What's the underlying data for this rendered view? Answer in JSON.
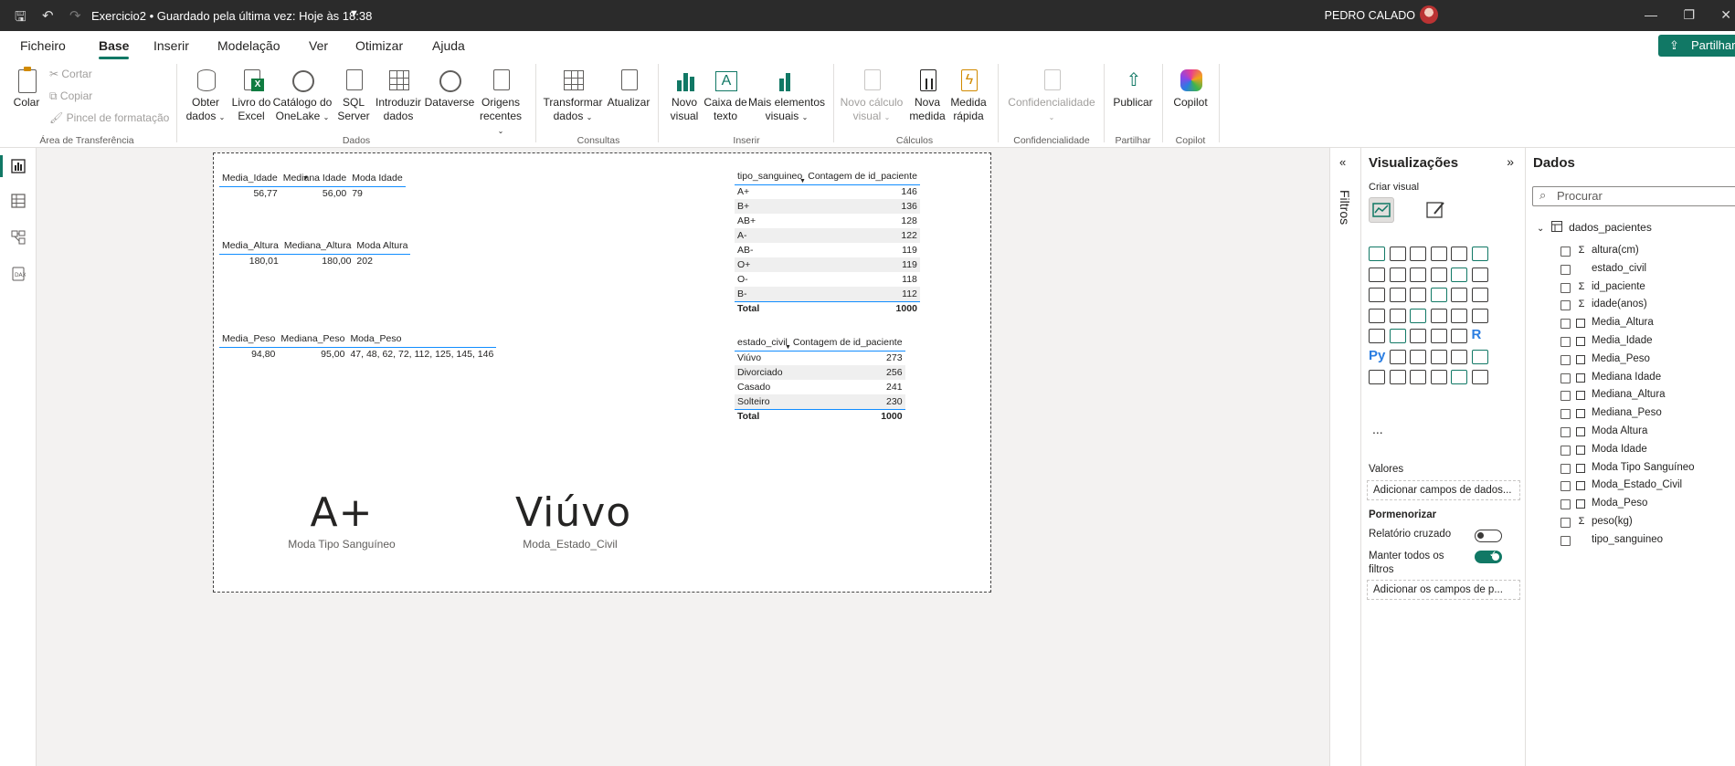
{
  "titlebar": {
    "title": "Exercicio2 • Guardado pela última vez: Hoje às 18:38",
    "user": "PEDRO CALADO"
  },
  "menu": {
    "tabs": [
      "Ficheiro",
      "Base",
      "Inserir",
      "Modelação",
      "Ver",
      "Otimizar",
      "Ajuda"
    ],
    "share": "Partilhar"
  },
  "ribbon": {
    "paste": "Colar",
    "cut": "Cortar",
    "copy": "Copiar",
    "format_painter": "Pincel de formatação",
    "get_data": [
      "Obter",
      "dados"
    ],
    "excel": [
      "Livro do",
      "Excel"
    ],
    "onelake": [
      "Catálogo do",
      "OneLake"
    ],
    "sql": [
      "SQL",
      "Server"
    ],
    "enter_data": [
      "Introduzir",
      "dados"
    ],
    "dataverse": "Dataverse",
    "recent": [
      "Origens",
      "recentes"
    ],
    "transform": [
      "Transformar",
      "dados"
    ],
    "refresh": "Atualizar",
    "new_visual": [
      "Novo",
      "visual"
    ],
    "text_box": [
      "Caixa de",
      "texto"
    ],
    "more_visuals": [
      "Mais elementos",
      "visuais"
    ],
    "new_calc": [
      "Novo cálculo",
      "visual"
    ],
    "new_measure": [
      "Nova",
      "medida"
    ],
    "quick_measure": [
      "Medida",
      "rápida"
    ],
    "sensitivity": "Confidencialidade",
    "publish": "Publicar",
    "copilot": "Copilot",
    "groups": {
      "clipboard": "Área de Transferência",
      "data": "Dados",
      "queries": "Consultas",
      "insert": "Inserir",
      "calculations": "Cálculos",
      "sensitivity": "Confidencialidade",
      "share": "Partilhar",
      "copilot": "Copilot"
    }
  },
  "report": {
    "idade": {
      "headers": [
        "Media_Idade",
        "Mediana Idade",
        "Moda Idade"
      ],
      "values": [
        "56,77",
        "56,00",
        "79"
      ]
    },
    "altura": {
      "headers": [
        "Media_Altura",
        "Mediana_Altura",
        "Moda Altura"
      ],
      "values": [
        "180,01",
        "180,00",
        "202"
      ]
    },
    "peso": {
      "headers": [
        "Media_Peso",
        "Mediana_Peso",
        "Moda_Peso"
      ],
      "values": [
        "94,80",
        "95,00",
        "47, 48, 62, 72, 112, 125, 145, 146"
      ]
    },
    "sangue": {
      "headers": [
        "tipo_sanguineo",
        "Contagem de id_paciente"
      ],
      "rows": [
        [
          "A+",
          "146"
        ],
        [
          "B+",
          "136"
        ],
        [
          "AB+",
          "128"
        ],
        [
          "A-",
          "122"
        ],
        [
          "AB-",
          "119"
        ],
        [
          "O+",
          "119"
        ],
        [
          "O-",
          "118"
        ],
        [
          "B-",
          "112"
        ]
      ],
      "total": [
        "Total",
        "1000"
      ]
    },
    "civil": {
      "headers": [
        "estado_civil",
        "Contagem de id_paciente"
      ],
      "rows": [
        [
          "Viúvo",
          "273"
        ],
        [
          "Divorciado",
          "256"
        ],
        [
          "Casado",
          "241"
        ],
        [
          "Solteiro",
          "230"
        ]
      ],
      "total": [
        "Total",
        "1000"
      ]
    },
    "card1": {
      "value": "A+",
      "label": "Moda Tipo Sanguíneo"
    },
    "card2": {
      "value": "Viúvo",
      "label": "Moda_Estado_Civil"
    }
  },
  "filters": {
    "label": "Filtros"
  },
  "viz": {
    "title": "Visualizações",
    "build": "Criar visual",
    "more": "...",
    "values_label": "Valores",
    "values_drop": "Adicionar campos de dados...",
    "drill_label": "Pormenorizar",
    "cross_report": "Relatório cruzado",
    "keep_filters": "Manter todos os filtros",
    "drill_drop": "Adicionar os campos de p..."
  },
  "data": {
    "title": "Dados",
    "search_placeholder": "Procurar",
    "table_name": "dados_pacientes",
    "fields": [
      {
        "name": "altura(cm)",
        "type": "sum"
      },
      {
        "name": "estado_civil",
        "type": "none"
      },
      {
        "name": "id_paciente",
        "type": "sum"
      },
      {
        "name": "idade(anos)",
        "type": "sum"
      },
      {
        "name": "Media_Altura",
        "type": "calc"
      },
      {
        "name": "Media_Idade",
        "type": "calc"
      },
      {
        "name": "Media_Peso",
        "type": "calc"
      },
      {
        "name": "Mediana Idade",
        "type": "calc"
      },
      {
        "name": "Mediana_Altura",
        "type": "calc"
      },
      {
        "name": "Mediana_Peso",
        "type": "calc"
      },
      {
        "name": "Moda Altura",
        "type": "calc"
      },
      {
        "name": "Moda Idade",
        "type": "calc"
      },
      {
        "name": "Moda Tipo Sanguíneo",
        "type": "calc"
      },
      {
        "name": "Moda_Estado_Civil",
        "type": "calc"
      },
      {
        "name": "Moda_Peso",
        "type": "calc"
      },
      {
        "name": "peso(kg)",
        "type": "sum"
      },
      {
        "name": "tipo_sanguineo",
        "type": "none"
      }
    ]
  },
  "colors": {
    "accent": "#117865",
    "titlebar": "#2b2b2b",
    "table_line": "#118dff"
  }
}
